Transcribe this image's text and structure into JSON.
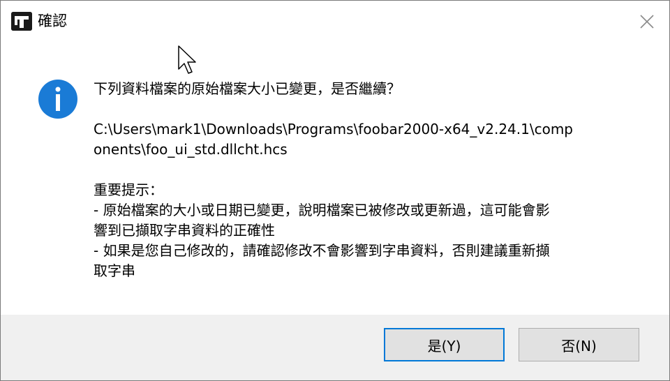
{
  "window": {
    "title": "確認",
    "app_icon": "foobar2000-app-icon",
    "close_icon": "close-icon"
  },
  "message": {
    "icon": "info-icon",
    "question": "下列資料檔案的原始檔案大小已變更，是否繼續？",
    "path_line1": "C:\\Users\\mark1\\Downloads\\Programs\\foobar2000-x64_v2.24.1\\comp",
    "path_line2": "onents\\foo_ui_std.dllcht.hcs",
    "notice_heading": "重要提示：",
    "notice_line1": "- 原始檔案的大小或日期已變更，說明檔案已被修改或更新過，這可能會影",
    "notice_line2": "響到已擷取字串資料的正確性",
    "notice_line3": "- 如果是您自己修改的，請確認修改不會影響到字串資料，否則建議重新擷",
    "notice_line4": "取字串"
  },
  "buttons": {
    "yes_label": "是(Y)",
    "no_label": "否(N)"
  },
  "colors": {
    "accent": "#0078d7",
    "info_icon": "#1a7bd6",
    "button_bar": "#f0f0f0"
  }
}
